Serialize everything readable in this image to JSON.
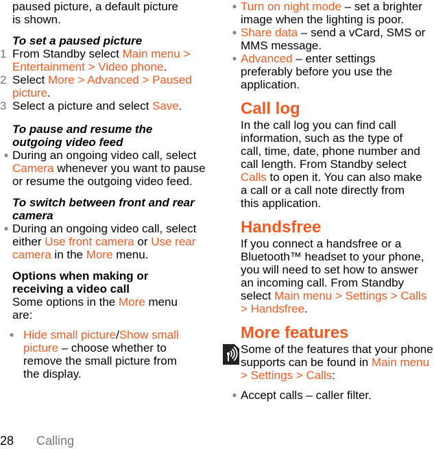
{
  "left": {
    "intro_line1": "paused picture, a default picture",
    "intro_line2": "is shown.",
    "set_paused": {
      "heading": "To set a paused picture",
      "steps": [
        {
          "num": "1",
          "pre": "From Standby select ",
          "link": "Main menu > Entertainment > Video phone",
          "post": "."
        },
        {
          "num": "2",
          "pre": "Select ",
          "link": "More > Advanced > Paused picture",
          "post": "."
        },
        {
          "num": "3",
          "pre": "Select a picture and select ",
          "link": "Save",
          "post": "."
        }
      ]
    },
    "pause_resume": {
      "heading": "To pause and resume the outgoing video feed",
      "bullet_pre": "During an ongoing video call, select ",
      "bullet_link": "Camera",
      "bullet_post": " whenever you want to pause or resume the outgoing video feed."
    },
    "switch_camera": {
      "heading": "To switch between front and rear camera",
      "bullet_pre": "During an ongoing video call, select either ",
      "link1": "Use front camera",
      "mid": " or ",
      "link2": "Use rear camera",
      "mid2": " in the ",
      "link3": "More",
      "post": " menu."
    },
    "options": {
      "heading": "Options when making or receiving a video call",
      "intro_pre": "Some options in the ",
      "intro_link": "More",
      "intro_post": " menu are:",
      "bullet_link1": "Hide small picture",
      "bullet_sep": "/",
      "bullet_link2": "Show small picture",
      "bullet_post": " – choose whether to remove the small picture from the display."
    }
  },
  "right": {
    "bullets": [
      {
        "link": "Turn on night mode",
        "post": " – set a brighter image when the lighting is poor."
      },
      {
        "link": "Share data",
        "post": " – send a vCard, SMS or MMS message."
      },
      {
        "link": "Advanced",
        "post": " – enter settings preferably before you use the application."
      }
    ],
    "call_log": {
      "title": "Call log",
      "body_pre": "In the call log you can find call information, such as the type of call, time, date, phone number and call length. From Standby select ",
      "body_link": "Calls",
      "body_post": " to open it. You can also make a call or a call note directly from this application."
    },
    "handsfree": {
      "title": "Handsfree",
      "body_pre": "If you connect a handsfree or a Bluetooth™ headset to your phone, you will need to set how to answer an incoming call. From Standby select ",
      "body_link": "Main menu > Settings > Calls > Handsfree",
      "body_post": "."
    },
    "more_features": {
      "icon": "network-service-icon",
      "title": "More features",
      "body_pre": "Some of the features that your phone supports can be found in ",
      "body_link": "Main menu > Settings > Calls",
      "body_post": ":",
      "bullet": "Accept calls – caller filter."
    }
  },
  "footer": {
    "page_number": "28",
    "chapter": "Calling"
  },
  "colors": {
    "highlight": "#f15a22",
    "muted": "#777777"
  }
}
